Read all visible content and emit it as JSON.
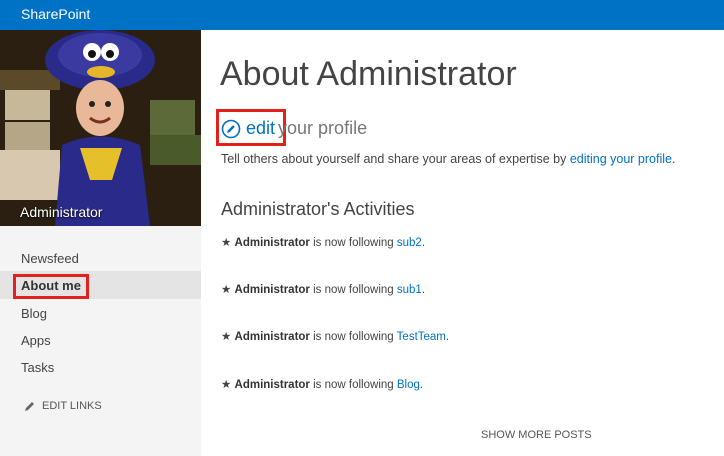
{
  "app": {
    "brand": "SharePoint",
    "accent": "#0072c6"
  },
  "profile": {
    "photo_name": "Administrator"
  },
  "nav": {
    "items": [
      "Newsfeed",
      "About me",
      "Blog",
      "Apps",
      "Tasks"
    ],
    "active": "About me",
    "edit_links": "EDIT LINKS"
  },
  "main": {
    "title": "About Administrator",
    "edit_link": "edit",
    "edit_rest": "your profile",
    "tell_text": "Tell others about yourself and share your areas of expertise by",
    "tell_link": "editing your profile",
    "tell_end": ".",
    "activities_heading": "Administrator's Activities",
    "activities": [
      {
        "user": "Administrator",
        "text": "is now following",
        "target": "sub2",
        "end": "."
      },
      {
        "user": "Administrator",
        "text": "is now following",
        "target": "sub1",
        "end": "."
      },
      {
        "user": "Administrator",
        "text": "is now following",
        "target": "TestTeam",
        "end": "."
      },
      {
        "user": "Administrator",
        "text": "is now following",
        "target": "Blog",
        "end": "."
      }
    ],
    "show_more": "SHOW MORE POSTS"
  }
}
